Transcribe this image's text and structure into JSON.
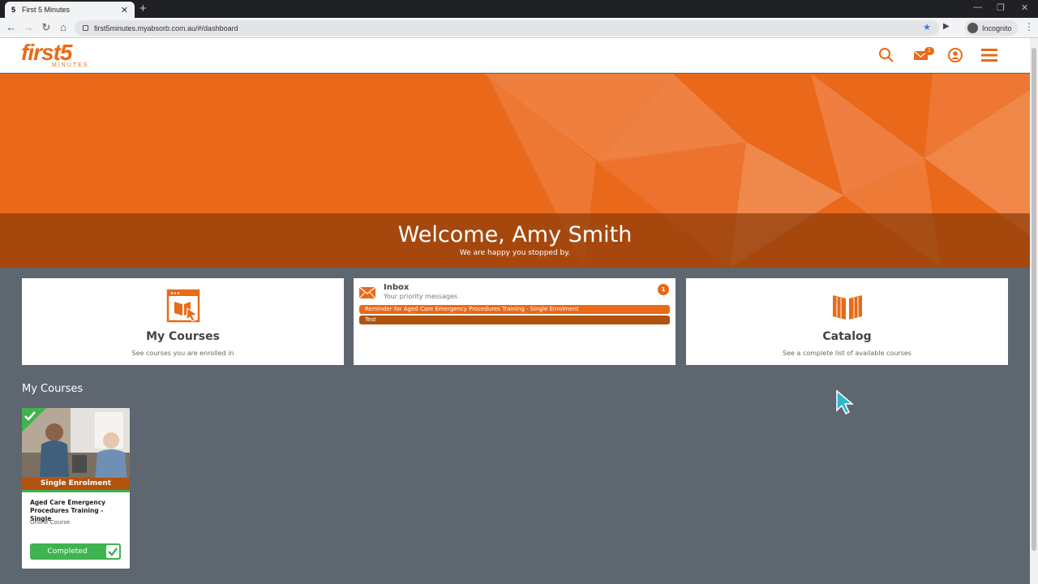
{
  "browser": {
    "tab_title": "First 5 Minutes",
    "tab_favicon": "5",
    "url": "first5minutes.myabsorb.com.au/#/dashboard",
    "incognito_label": "Incognito"
  },
  "header": {
    "logo_main": "first5",
    "logo_sub": "MINUTES",
    "mail_badge": "1",
    "icons": [
      "search-icon",
      "mail-icon",
      "user-icon",
      "menu-icon"
    ]
  },
  "banner": {
    "welcome": "Welcome, Amy Smith",
    "subtitle": "We are happy you stopped by."
  },
  "tiles": {
    "my_courses": {
      "title": "My Courses",
      "desc": "See courses you are enrolled in"
    },
    "inbox": {
      "title": "Inbox",
      "subtitle": "Your priority messages",
      "badge": "1",
      "messages": [
        {
          "text": "Reminder for Aged Care Emergency Procedures Training - Single Enrolment",
          "color": "#ea6a17"
        },
        {
          "text": "Test",
          "color": "#b2520f"
        }
      ]
    },
    "catalog": {
      "title": "Catalog",
      "desc": "See a complete list of available courses"
    }
  },
  "my_courses_section": {
    "title": "My Courses",
    "courses": [
      {
        "label": "Single Enrolment",
        "name": "Aged Care Emergency Procedures Training - Single",
        "type": "Online Course",
        "status": "Completed"
      }
    ]
  },
  "colors": {
    "brand": "#ea6a17",
    "brand_dark": "#b2520f",
    "success": "#3fb34f",
    "page_bg": "#5e6670"
  }
}
